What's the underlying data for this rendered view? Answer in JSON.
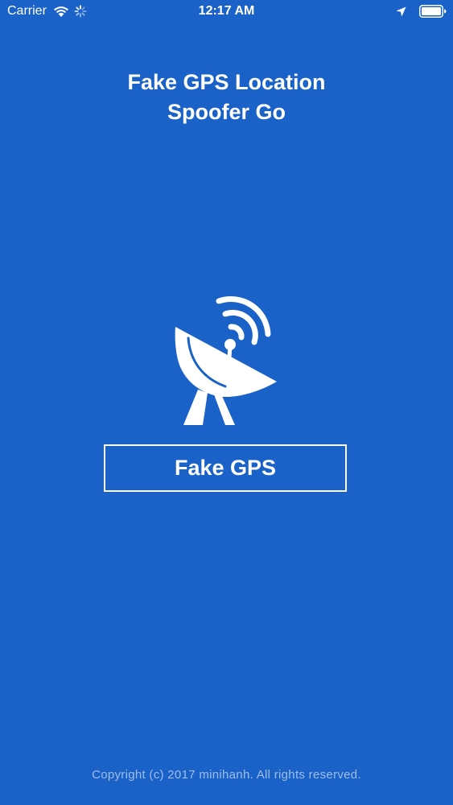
{
  "status_bar": {
    "carrier": "Carrier",
    "time": "12:17 AM",
    "icons": [
      "wifi-icon",
      "activity-spinner-icon",
      "location-arrow-icon",
      "battery-icon"
    ]
  },
  "app": {
    "title_line1": "Fake GPS Location",
    "title_line2": "Spoofer Go",
    "icon": "satellite-dish-icon",
    "button_label": "Fake GPS",
    "copyright": "Copyright (c) 2017 minihanh. All rights reserved."
  },
  "colors": {
    "background": "#1b62c8",
    "foreground": "#ffffff",
    "copyright_text": "#9fbde9"
  }
}
